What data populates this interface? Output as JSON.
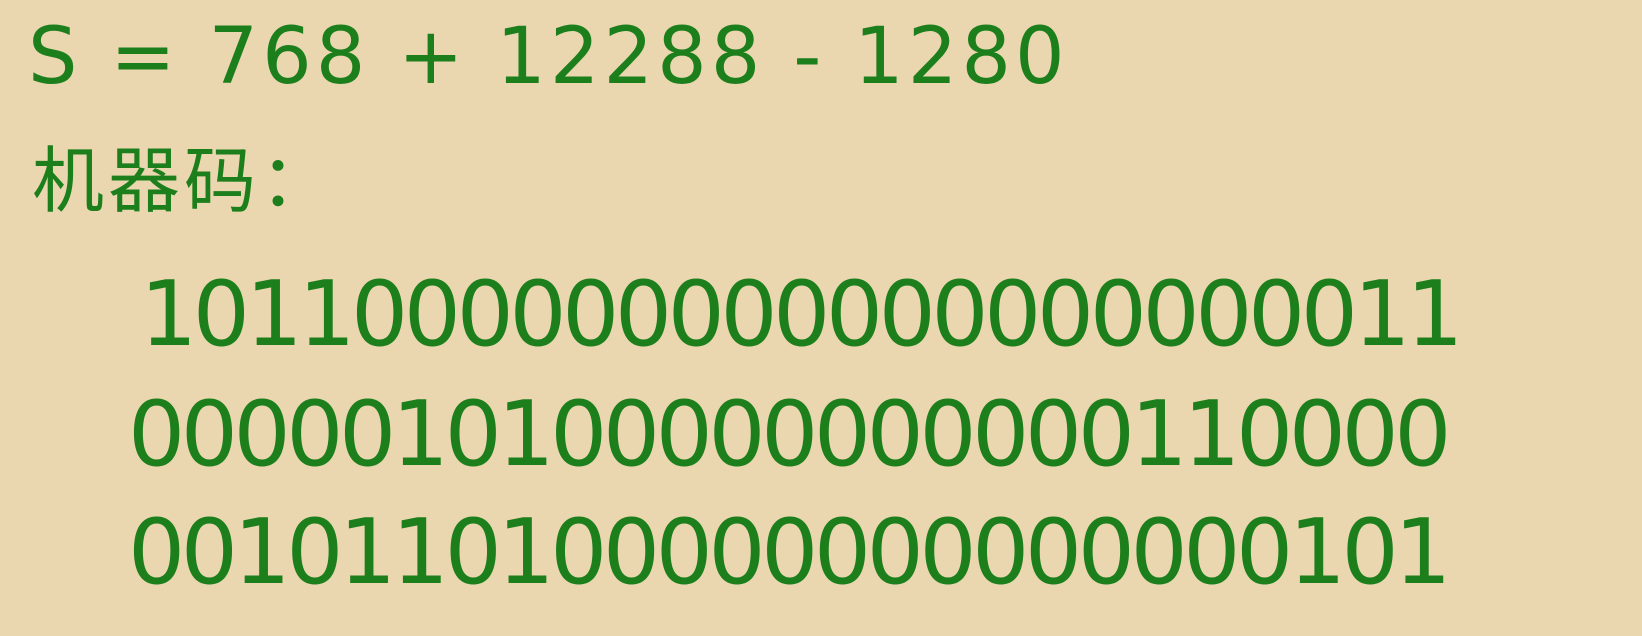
{
  "formula": "S = 768 + 12288 - 1280",
  "label": "机器码：",
  "machine_code_lines": [
    "1011000000000000000000011",
    "0000010100000000000110000",
    "0010110100000000000000101"
  ]
}
